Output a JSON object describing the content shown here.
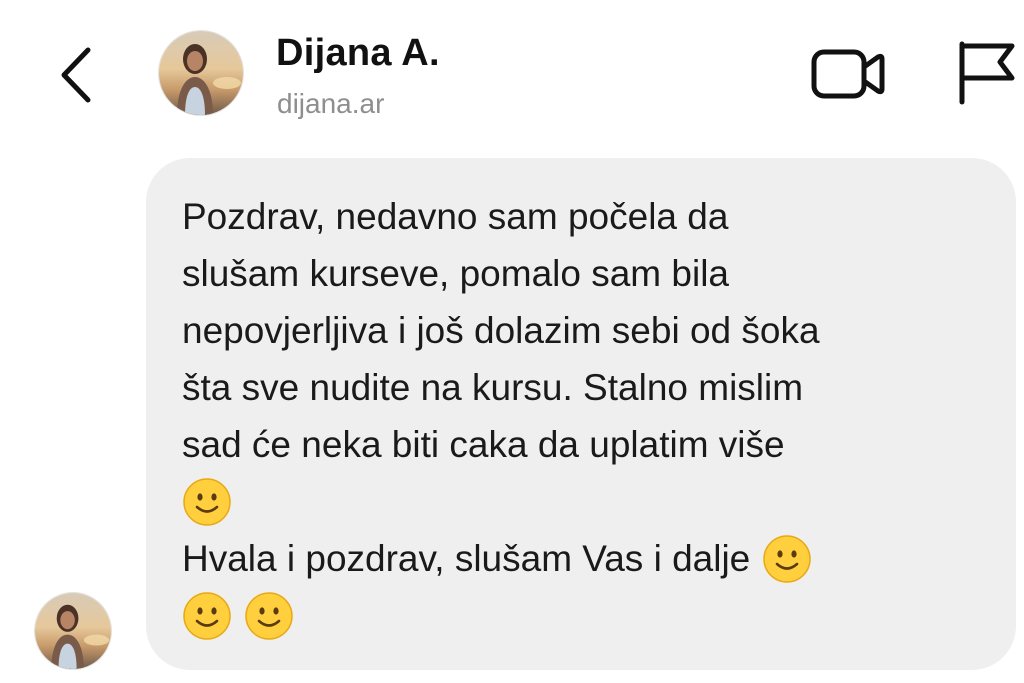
{
  "header": {
    "contact_name": "Dijana A.",
    "contact_username": "dijana.ar",
    "icons": {
      "back": "chevron-left-icon",
      "video": "video-camera-icon",
      "flag": "flag-icon"
    }
  },
  "message": {
    "lines": [
      "Pozdrav, nedavno sam počela da",
      "slušam kurseve, pomalo sam bila",
      "nepovjerljiva i još dolazim sebi od šoka",
      "šta sve nudite na kursu. Stalno mislim",
      "sad će neka biti caka da uplatim više",
      "",
      "Hvala i pozdrav, slušam Vas i dalje",
      ""
    ],
    "emoji": "slightly-smiling-face"
  },
  "colors": {
    "bubble_background": "#efefef",
    "username_gray": "#8e8e8e",
    "emoji_yellow": "#ffcf3d"
  }
}
